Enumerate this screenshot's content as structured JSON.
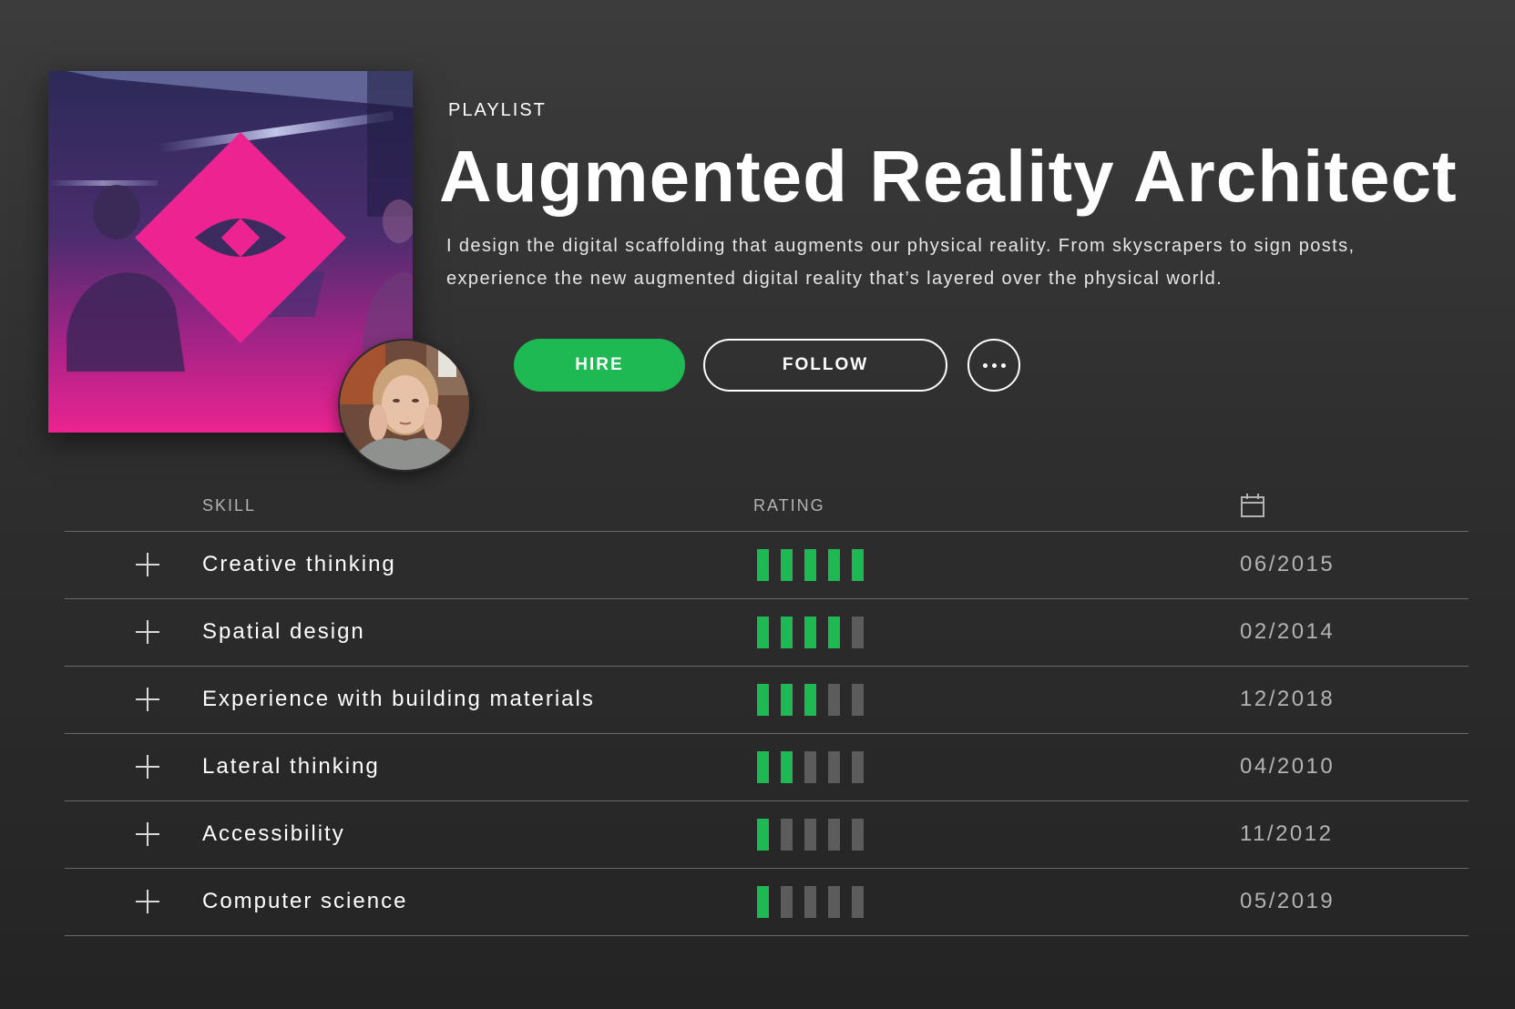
{
  "header": {
    "eyebrow": "PLAYLIST",
    "title": "Augmented Reality Architect",
    "description": "I design the digital scaffolding that augments our physical reality. From skyscrapers to sign posts, experience the new augmented digital reality that’s layered over the physical world."
  },
  "actions": {
    "hire_label": "HIRE",
    "follow_label": "FOLLOW",
    "more_icon": "more-dots-icon"
  },
  "colors": {
    "accent": "#1fb954",
    "brand_pink": "#ec2390",
    "background": "#2e2e2e",
    "rating_off": "#5c5c5c"
  },
  "table": {
    "columns": {
      "skill": "SKILL",
      "rating": "RATING",
      "date_icon": "calendar-icon"
    },
    "rating_max": 5,
    "rows": [
      {
        "skill": "Creative thinking",
        "rating": 5,
        "date": "06/2015"
      },
      {
        "skill": "Spatial design",
        "rating": 4,
        "date": "02/2014"
      },
      {
        "skill": "Experience with building materials",
        "rating": 3,
        "date": "12/2018"
      },
      {
        "skill": "Lateral thinking",
        "rating": 2,
        "date": "04/2010"
      },
      {
        "skill": "Accessibility",
        "rating": 1,
        "date": "11/2012"
      },
      {
        "skill": "Computer science",
        "rating": 1,
        "date": "05/2019"
      }
    ]
  }
}
